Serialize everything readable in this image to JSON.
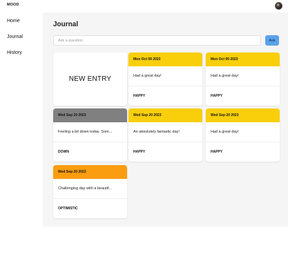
{
  "app": {
    "brand": "MOOD"
  },
  "sidebar": {
    "items": [
      {
        "label": "Home"
      },
      {
        "label": "Journal"
      },
      {
        "label": "History"
      }
    ]
  },
  "main": {
    "title": "Journal",
    "ask": {
      "placeholder": "Ask a question",
      "button_label": "Ask"
    },
    "new_entry_label": "NEW ENTRY",
    "entries": [
      {
        "date": "Mon Oct 09 2023",
        "content": "Had a great day!",
        "mood": "HAPPY",
        "color": "#f8cf0a"
      },
      {
        "date": "Mon Oct 09 2023",
        "content": "Had a great day!",
        "mood": "HAPPY",
        "color": "#f8cf0a"
      },
      {
        "date": "Wed Sep 20 2023",
        "content": "Feeling a bit down today. Som...",
        "mood": "DOWN",
        "color": "#808080"
      },
      {
        "date": "Wed Sep 20 2023",
        "content": "An absolutely fantastic day!",
        "mood": "HAPPY",
        "color": "#f8cf0a"
      },
      {
        "date": "Wed Sep 20 2023",
        "content": "Had a great day!",
        "mood": "HAPPY",
        "color": "#f8cf0a"
      },
      {
        "date": "Wed Sep 20 2023",
        "content": "Challenging day with a beautif...",
        "mood": "OPTIMISTIC",
        "color": "#fa9d10"
      }
    ]
  }
}
